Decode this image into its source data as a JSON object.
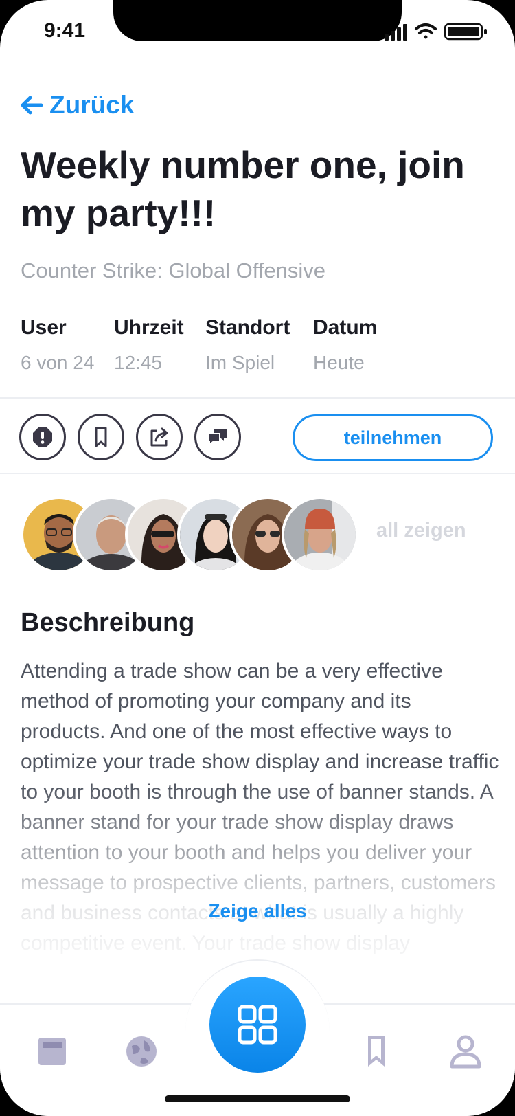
{
  "status": {
    "time": "9:41"
  },
  "nav": {
    "back_label": "Zurück",
    "back_icon": "arrow-left-icon"
  },
  "event": {
    "title": "Weekly number one, join my party!!!",
    "game": "Counter Strike: Global Offensive"
  },
  "meta": [
    {
      "key": "User",
      "value": "6 von 24"
    },
    {
      "key": "Uhrzeit",
      "value": "12:45"
    },
    {
      "key": "Standort",
      "value": "Im Spiel"
    },
    {
      "key": "Datum",
      "value": "Heute"
    }
  ],
  "actions": {
    "icons": [
      "report-icon",
      "bookmark-icon",
      "share-icon",
      "chat-icon"
    ],
    "join_label": "teilnehmen"
  },
  "participants": {
    "show_all_label": "all zeigen"
  },
  "description": {
    "heading": "Beschreibung",
    "text": "Attending a trade show can be a very effective method of promoting your company and its products. And one of the most effective ways to optimize your trade show display and increase traffic to your booth is through the use of banner stands. A banner stand for your trade show display draws attention to your booth and helps you deliver your message to prospective clients, partners, customers and business contacts at what is usually a highly competitive event. Your trade show display",
    "show_more_label": "Zeige alles"
  },
  "tabbar": {
    "items": [
      "news-icon",
      "globe-icon",
      "grid-icon",
      "bookmark-icon",
      "profile-icon"
    ]
  },
  "colors": {
    "accent": "#1a8ff0",
    "text": "#1b1c24",
    "muted": "#a3a7ae"
  }
}
